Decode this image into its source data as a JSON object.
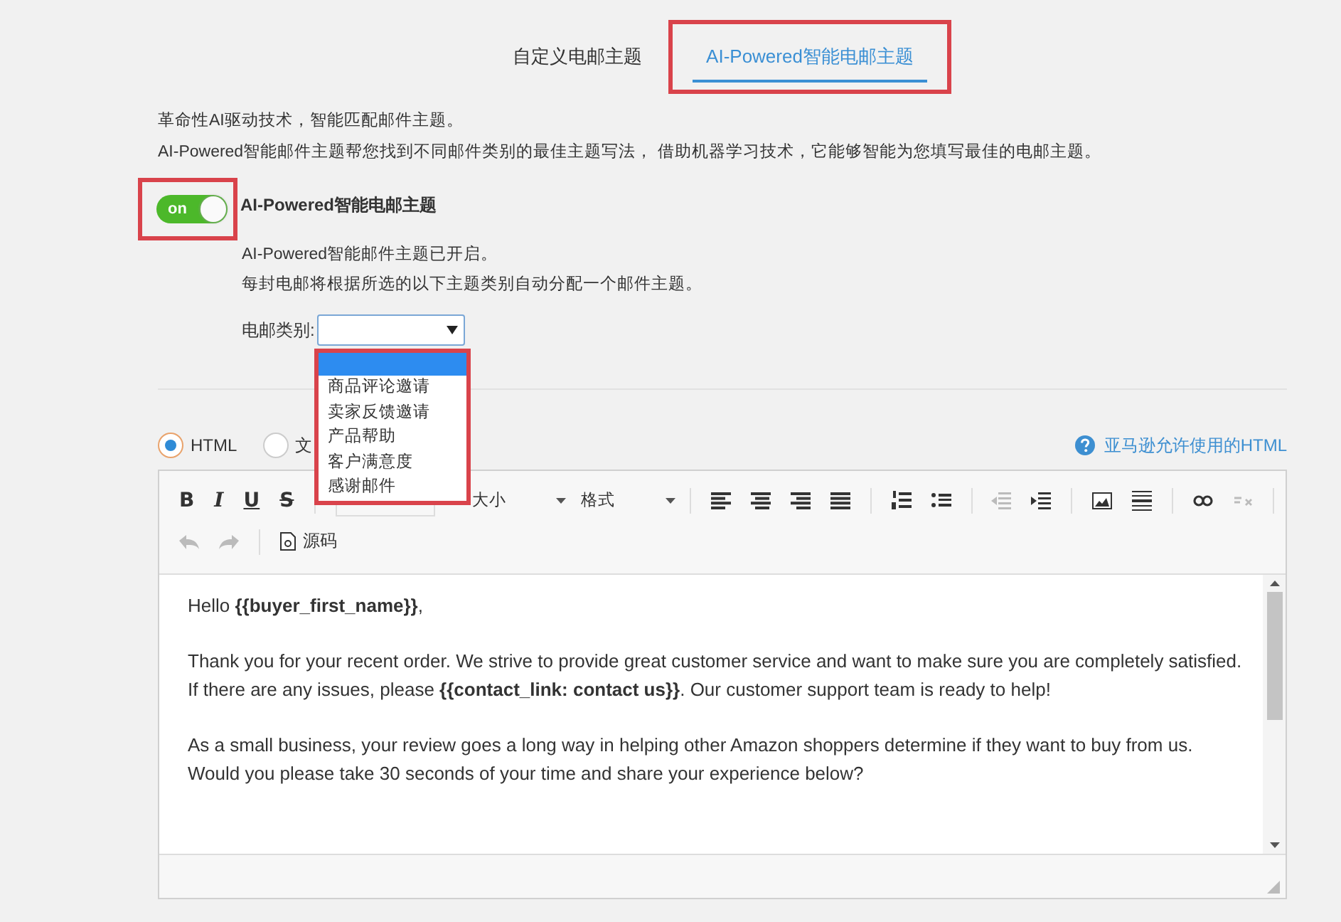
{
  "tabs": [
    {
      "label": "自定义电邮主题",
      "selected": false
    },
    {
      "label": "AI-Powered智能电邮主题",
      "selected": true
    }
  ],
  "intro": [
    "革命性AI驱动技术，智能匹配邮件主题。",
    "AI-Powered智能邮件主题帮您找到不同邮件类别的最佳主题写法， 借助机器学习技术，它能够智能为您填写最佳的电邮主题。"
  ],
  "toggle": {
    "on": true,
    "label": "on",
    "title": "AI-Powered智能电邮主题"
  },
  "status_lines": [
    "AI-Powered智能邮件主题已开启。",
    "每封电邮将根据所选的以下主题类别自动分配一个邮件主题。"
  ],
  "category": {
    "label": "电邮类别:",
    "open": true,
    "options": [
      "商品评论邀请",
      "卖家反馈邀请",
      "产品帮助",
      "客户满意度",
      "感谢邮件"
    ]
  },
  "format_radios": [
    {
      "label": "HTML",
      "selected": true
    },
    {
      "label": "文",
      "selected": false
    }
  ],
  "help_link": "亚马逊允许使用的HTML",
  "toolbar": {
    "style_buttons": [
      "B",
      "I",
      "U",
      "S"
    ],
    "dropdowns": [
      "大小",
      "格式"
    ],
    "source_button": "源码"
  },
  "body": [
    "Hello **{{buyer_first_name}}**,",
    "Thank you for your recent order. We strive to provide great customer service and want to make sure you are completely satisfied. If there are any issues, please **{{contact_link: contact us}}**. Our customer support team is ready to help!",
    "As a small business, your review goes a long way in helping other Amazon shoppers determine if they want to buy from us. Would you please take 30 seconds of your time and share your experience below?"
  ]
}
